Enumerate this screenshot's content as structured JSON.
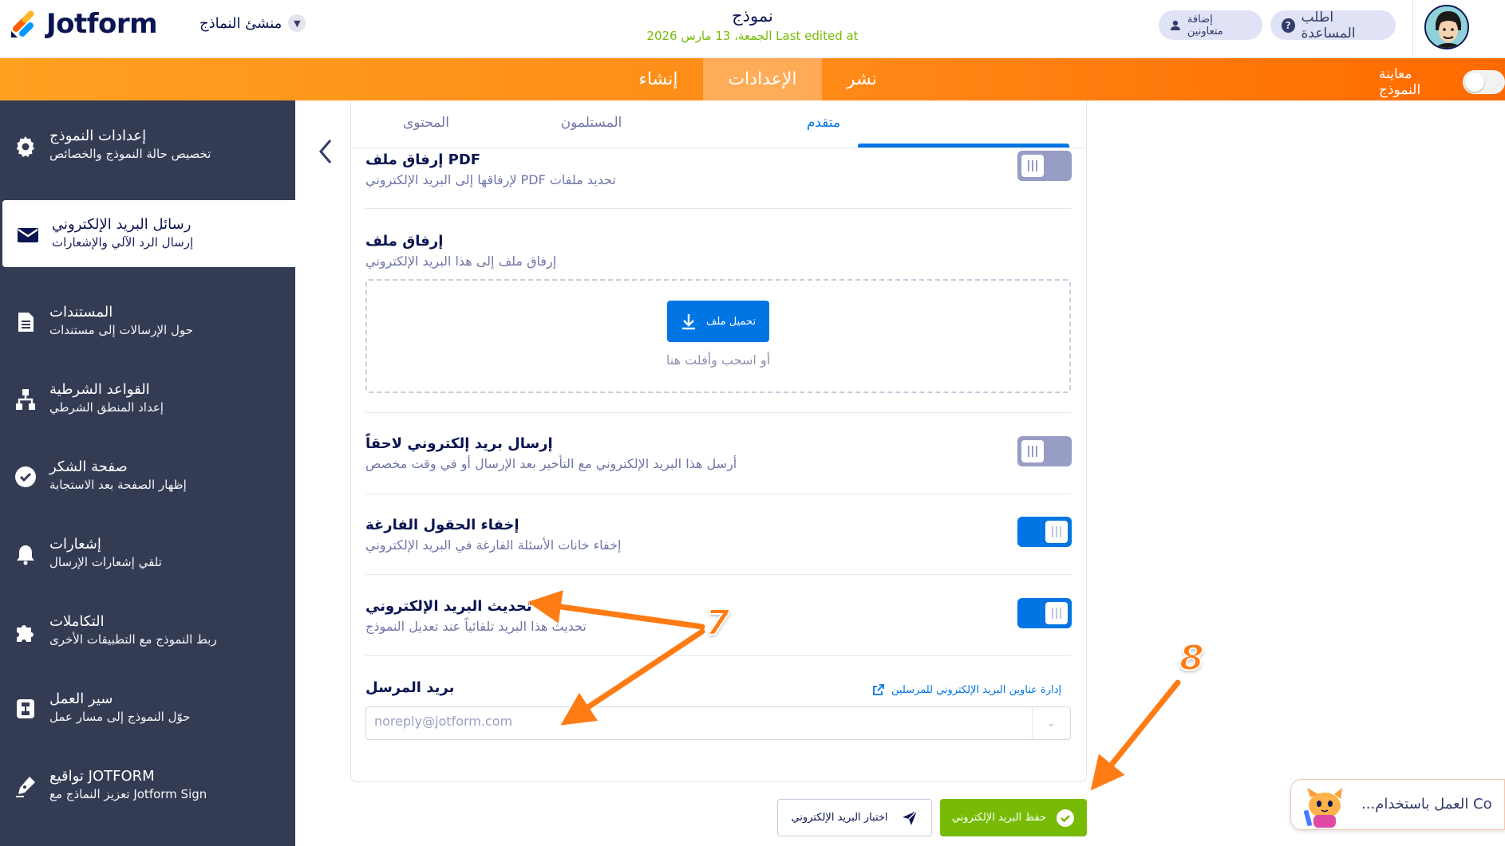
{
  "header": {
    "logo_text": "Jotform",
    "builder_menu": "منشئ النماذج",
    "form_title": "نموذج",
    "last_edited": "الجمعة، 13 مارس 2026 Last edited at",
    "add_collaborators": "إضافة متعاونين",
    "get_help": "اطلب المساعدة"
  },
  "nav": {
    "create": "إنشاء",
    "settings": "الإعدادات",
    "publish": "نشر",
    "preview_label": "معاينة النموذج"
  },
  "sidebar": {
    "items": [
      {
        "title": "إعدادات النموذج",
        "desc": "تخصيص حالة النموذج والخصائص",
        "icon": "gear-icon"
      },
      {
        "title": "رسائل البريد الإلكتروني",
        "desc": "إرسال الرد الآلي والإشعارات",
        "icon": "envelope-icon"
      },
      {
        "title": "المستندات",
        "desc": "حول الإرسالات إلى مستندات",
        "icon": "document-icon"
      },
      {
        "title": "القواعد الشرطية",
        "desc": "إعداد المنطق الشرطي",
        "icon": "hierarchy-icon"
      },
      {
        "title": "صفحة الشكر",
        "desc": "إظهار الصفحة بعد الاستجابة",
        "icon": "check-circle-icon"
      },
      {
        "title": "إشعارات",
        "desc": "تلقي إشعارات الإرسال",
        "icon": "bell-icon"
      },
      {
        "title": "التكاملات",
        "desc": "ربط النموذج مع التطبيقات الأخرى",
        "icon": "puzzle-icon"
      },
      {
        "title": "سير العمل",
        "desc": "حوّل النموذج إلى مسار عمل",
        "icon": "workflow-icon"
      },
      {
        "title": "تواقيع JOTFORM",
        "desc": "تعزيز النماذج مع Jotform Sign",
        "icon": "pen-icon"
      }
    ],
    "active_index": 1
  },
  "tabs": {
    "advanced": "متقدم",
    "recipients": "المستلمون",
    "content": "المحتوى"
  },
  "settings": {
    "pdf_title": "إرفاق ملف PDF",
    "pdf_desc": "لإرفاقها إلى البريد الإلكتروني PDF تحديد ملفات",
    "pdf_on": false,
    "attach_title": "إرفاق ملف",
    "attach_desc": "إرفاق ملف إلى هذا البريد الإلكتروني",
    "upload_label": "تحميل ملف",
    "drop_text": "أو اسحب وأفلت هنا",
    "later_title": "إرسال بريد إلكتروني لاحقاً",
    "later_desc": "أرسل هذا البريد الإلكتروني مع التأخير بعد الإرسال أو في وقت مخصص",
    "later_on": false,
    "hide_title": "إخفاء الحقول الفارغة",
    "hide_desc": "إخفاء خانات الأسئلة الفارغة في البريد الإلكتروني",
    "hide_on": true,
    "update_title": "تحديث البريد الإلكتروني",
    "update_desc": "تحديث هذا البريد تلقائياً عند تعديل النموذج",
    "update_on": true,
    "sender_title": "بريد المرسل",
    "manage_link": "إدارة عناوين البريد الإلكتروني للمرسلين",
    "sender_value": "noreply@jotform.com"
  },
  "actions": {
    "test_email": "اختبار البريد الإلكتروني",
    "save_email": "حفظ البريد الإلكتروني"
  },
  "assistant": {
    "text": "...العمل باستخدام Co"
  },
  "annotations": {
    "step7": "7",
    "step8": "8"
  },
  "colors": {
    "orange_nav": "#ff8a17",
    "sidebar_bg": "#343c54",
    "primary_blue": "#0075e3",
    "save_green": "#78bb07",
    "annotation_orange": "#ff7b14"
  }
}
